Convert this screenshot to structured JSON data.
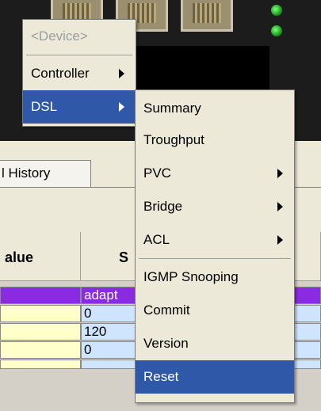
{
  "menu_device": {
    "items": [
      {
        "label": "<Device>",
        "disabled": true
      },
      {
        "label": "Controller",
        "has_submenu": true
      },
      {
        "label": "DSL",
        "has_submenu": true,
        "selected": true
      }
    ]
  },
  "menu_dsl": {
    "items": [
      {
        "label": "Summary"
      },
      {
        "label": "Troughput"
      },
      {
        "label": "PVC",
        "has_submenu": true
      },
      {
        "label": "Bridge",
        "has_submenu": true
      },
      {
        "label": "ACL",
        "has_submenu": true
      },
      {
        "label": "IGMP Snooping"
      },
      {
        "label": "Commit"
      },
      {
        "label": "Version"
      },
      {
        "label": "Reset",
        "selected": true
      }
    ]
  },
  "tab": {
    "label": "l History"
  },
  "grid": {
    "header_value": "alue",
    "header_s": "S",
    "rows": [
      {
        "s": "adapt"
      },
      {
        "s": "0"
      },
      {
        "s": "120"
      },
      {
        "s": "0"
      }
    ]
  },
  "colors": {
    "menu_bg": "#ece9d8",
    "selected": "#2f59a8",
    "purple": "#8a2be2"
  }
}
